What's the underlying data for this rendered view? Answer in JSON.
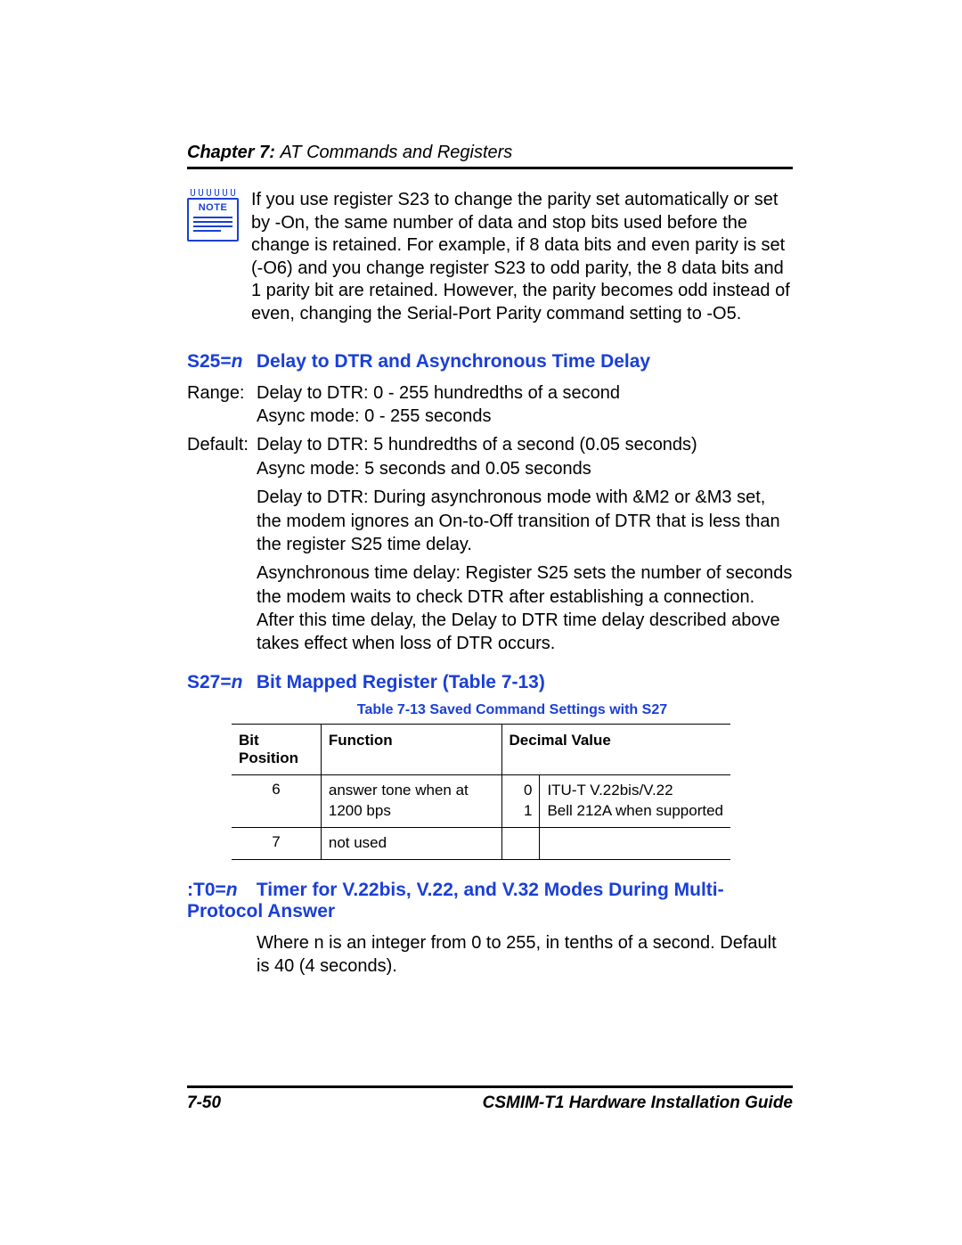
{
  "header": {
    "chapter_label": "Chapter 7: ",
    "chapter_title": "AT Commands and Registers"
  },
  "note": {
    "label": "NOTE",
    "text": "If you use register S23 to change the parity set automatically or set by -On, the same number of data and stop bits used before the change is retained. For example, if 8 data bits and even parity is set (-O6) and you change register S23 to odd parity, the 8 data bits and 1 parity bit are retained. However, the parity becomes odd instead of even, changing the Serial-Port Parity command setting to -O5."
  },
  "s25": {
    "cmd": "S25=",
    "n": "n",
    "title": "Delay to DTR and Asynchronous Time Delay",
    "range_label": "Range:",
    "range_line1": "Delay to DTR: 0 - 255 hundredths of a second",
    "range_line2": "Async mode: 0 - 255 seconds",
    "default_label": "Default:",
    "default_line1": "Delay to DTR: 5 hundredths of a second (0.05 seconds)",
    "default_line2": "Async mode: 5 seconds and 0.05 seconds",
    "para1": "Delay to DTR: During asynchronous mode with &M2 or &M3 set, the modem ignores an On-to-Off transition of DTR that is less than the register S25 time delay.",
    "para2": "Asynchronous time delay: Register S25 sets the number of seconds the modem waits to check DTR after establishing a connection. After this time delay, the Delay to DTR time delay described above takes effect when loss of DTR occurs."
  },
  "s27": {
    "cmd": "S27=",
    "n": "n",
    "title": "Bit Mapped Register (Table 7-13)",
    "caption": "Table 7-13   Saved Command Settings with S27",
    "headers": {
      "pos": "Bit Position",
      "fn": "Function",
      "dec": "Decimal Value"
    },
    "rows": [
      {
        "pos": "6",
        "fn": "answer tone when at 1200 bps",
        "codes": "0\n1",
        "desc": "ITU-T V.22bis/V.22\nBell 212A when supported"
      },
      {
        "pos": "7",
        "fn": "not used",
        "codes": "",
        "desc": ""
      }
    ]
  },
  "t0": {
    "cmd": ":T0=",
    "n": "n",
    "title": "Timer for V.22bis, V.22, and V.32 Modes During Multi-Protocol Answer",
    "para": "Where n is an integer from 0 to 255, in tenths of a second. Default is 40 (4 seconds)."
  },
  "footer": {
    "page": "7-50",
    "doc": "CSMIM-T1 Hardware Installation Guide"
  }
}
